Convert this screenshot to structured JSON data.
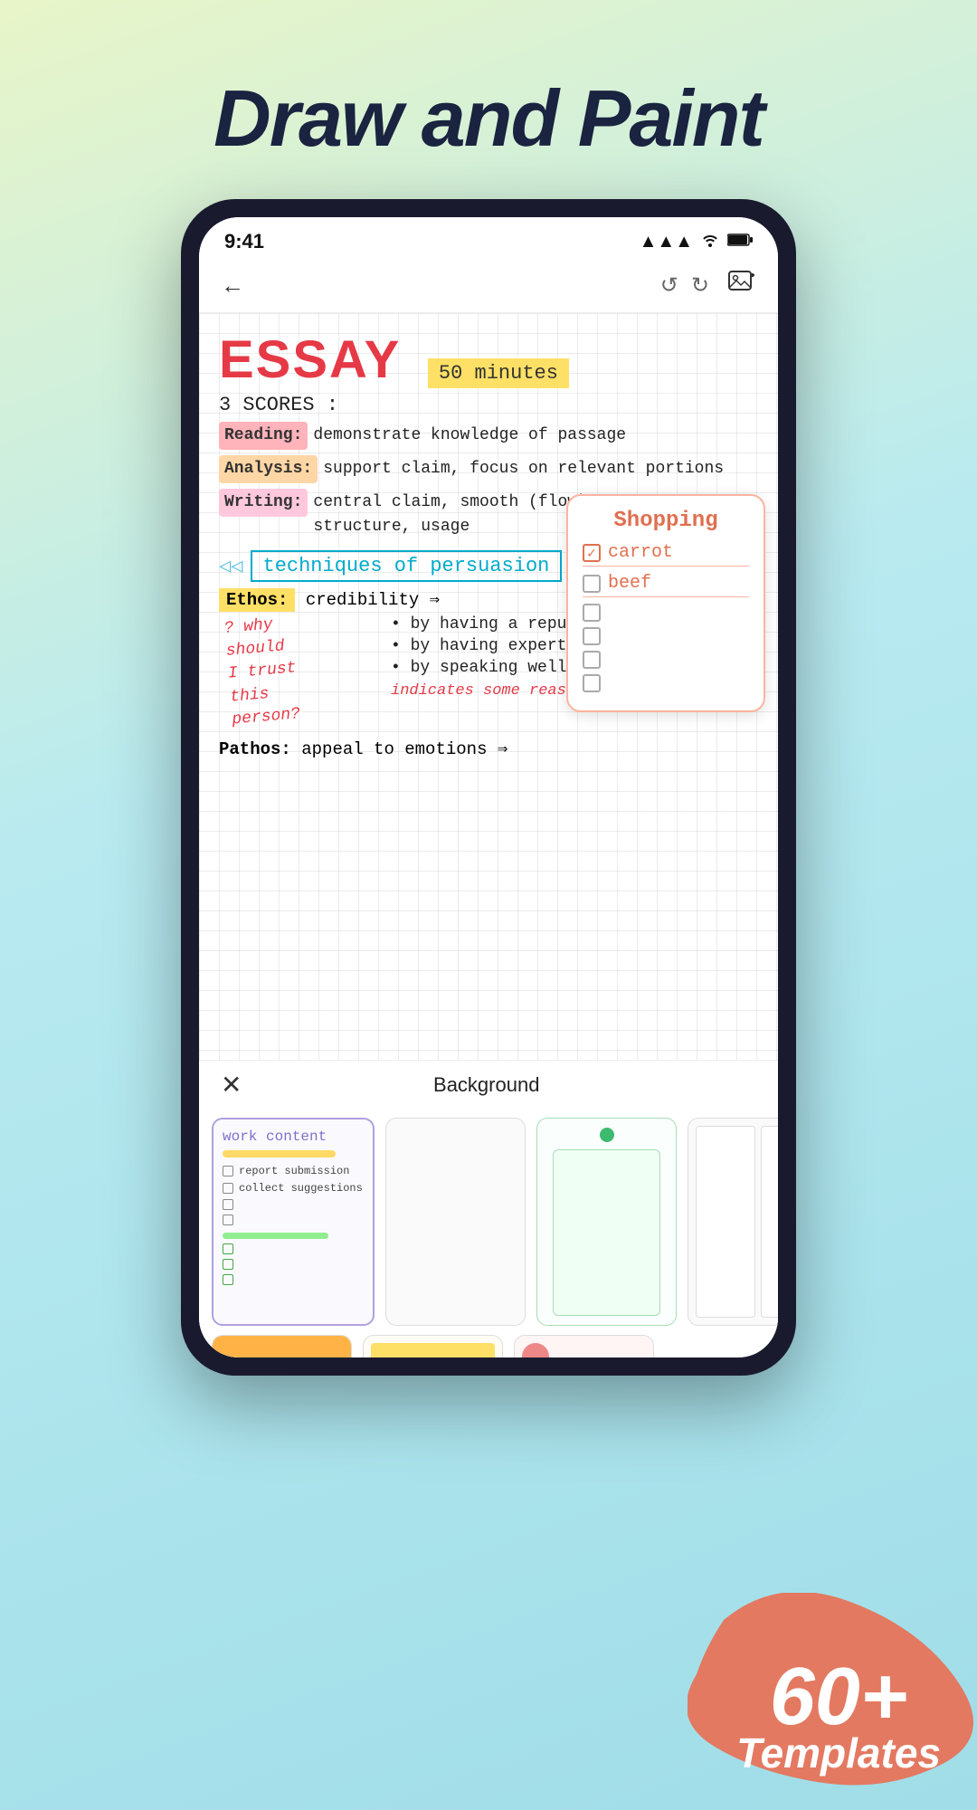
{
  "page": {
    "title": "Draw and Paint",
    "badge": {
      "number": "60+",
      "label": "Templates"
    }
  },
  "phone": {
    "status": {
      "time": "9:41",
      "signal": "▲▲▲",
      "wifi": "wifi",
      "battery": "battery"
    },
    "toolbar": {
      "background_label": "Background",
      "close_icon": "✕"
    }
  },
  "note": {
    "essay_title": "ESSAY",
    "minutes": "50 minutes",
    "scores_heading": "3 SCORES :",
    "scores": [
      {
        "label": "Reading:",
        "text": "demonstrate knowledge of passage",
        "style": "reading"
      },
      {
        "label": "Analysis:",
        "text": "support claim, focus on relevant portions",
        "style": "analysis"
      },
      {
        "label": "Writing:",
        "text": "central claim, smooth (flow) , sentence structure , usage",
        "style": "writing"
      }
    ],
    "persuasion_heading": "techniques of persuasion",
    "ethos_label": "Ethos:",
    "ethos_text": "credibility ⇒",
    "question": "? why should\nI trust this\nperson?",
    "bullets": [
      "· by having a reputation f...",
      "· by having expertise in a f...",
      "· by speaking well/using la..."
    ],
    "indicates": "indicates some reason for belief...",
    "pathos_label": "Pathos:",
    "pathos_text": "appeal to emotions ⇒"
  },
  "shopping": {
    "title": "Shopping",
    "items": [
      {
        "text": "carrot",
        "checked": true
      },
      {
        "text": "beef",
        "checked": false
      },
      {
        "text": "",
        "checked": false
      },
      {
        "text": "",
        "checked": false
      },
      {
        "text": "",
        "checked": false
      },
      {
        "text": "",
        "checked": false
      }
    ]
  },
  "templates": {
    "work_card": {
      "title": "work content",
      "bar1": "yellow",
      "items": [
        "report submission",
        "collect suggestions"
      ],
      "bar2": "green"
    },
    "strip2_label": "orange bar",
    "count": "60+",
    "count_label": "Templates"
  }
}
